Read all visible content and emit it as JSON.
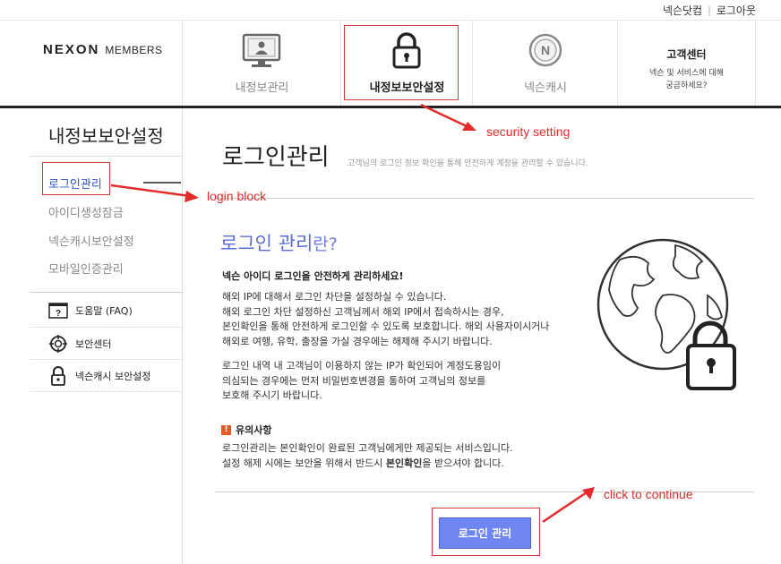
{
  "util": {
    "link1": "넥슨닷컴",
    "link2": "로그아웃"
  },
  "logo": {
    "brand": "NEXON",
    "sub": "MEMBERS"
  },
  "nav": {
    "info": "내정보관리",
    "security": "내정보보안설정",
    "cash": "넥슨캐시",
    "cs_title": "고객센터",
    "cs_desc1": "넥슨 및 서비스에 대해",
    "cs_desc2": "궁금하세요?"
  },
  "sidebar": {
    "title": "내정보보안설정",
    "items": [
      "로그인관리",
      "아이디생성잠금",
      "넥슨캐시보안설정",
      "모바일인증관리"
    ],
    "links": [
      "도움말 (FAQ)",
      "보안센터",
      "넥슨캐시 보안설정"
    ]
  },
  "main": {
    "title": "로그인관리",
    "desc": "고객님의 로그인 정보 확인을 통해 안전하게 계정을 관리할 수 있습니다.",
    "what_title": "로그인 관리",
    "what_suffix": "란?",
    "intro_head": "넥슨 아이디 로그인을 안전하게 관리하세요!",
    "para1": [
      "해외 IP에 대해서 로그인 차단을 설정하실 수 있습니다.",
      "해외 로그인 차단 설정하신 고객님께서 해외 IP에서 접속하시는 경우,",
      "본인확인을 통해 안전하게 로그인할 수 있도록 보호합니다. 해외 사용자이시거나",
      "해외로 여행, 유학, 출장을 가실 경우에는 해제해 주시기 바랍니다."
    ],
    "para2": [
      "로그인 내역 내 고객님이 이용하지 않는 IP가 확인되어 계정도용임이",
      "의심되는 경우에는 먼저 비밀번호변경을 통하여 고객님의 정보를",
      "보호해 주시기 바랍니다."
    ],
    "caution_title": "유의사항",
    "caution1": "로그인관리는 본인확인이 완료된 고객님에게만 제공되는 서비스입니다.",
    "caution2_pre": "설정 해제 시에는 보안을 위해서 반드시 ",
    "caution2_bold": "본인확인",
    "caution2_post": "을 받으셔야 합니다.",
    "button": "로그인 관리"
  },
  "annotations": {
    "security": "security setting",
    "login": "login block",
    "continue": "click to continue"
  },
  "colors": {
    "accent": "#5b6bd8",
    "button": "#6f86f2",
    "annotation": "#e32b2b",
    "active_link": "#2f56c6"
  }
}
